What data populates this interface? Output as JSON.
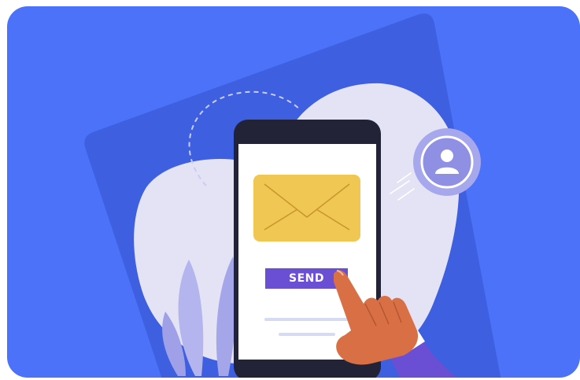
{
  "phone": {
    "send_button_label": "SEND"
  },
  "icons": {
    "envelope": "envelope-icon",
    "user": "user-avatar-icon",
    "hand": "pointing-hand"
  },
  "colors": {
    "background": "#4b72f8",
    "back_panel": "#3d5fe0",
    "blob": "#e3e3f5",
    "phone_frame": "#232338",
    "phone_screen": "#ffffff",
    "envelope": "#f0c752",
    "send_button": "#6a4fd4",
    "hand": "#d86f45",
    "sleeve": "#6a4fd4",
    "avatar_ring": "#a7a7ee"
  }
}
